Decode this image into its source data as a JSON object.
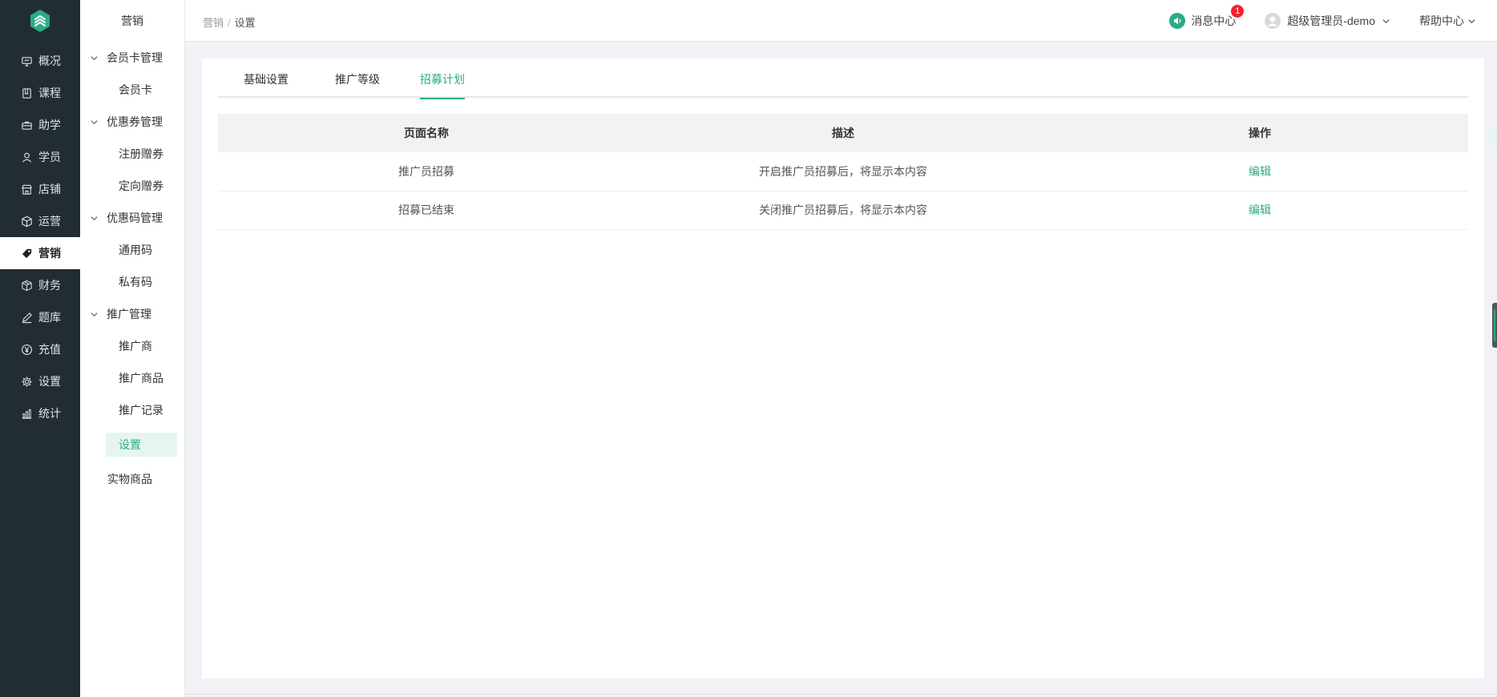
{
  "colors": {
    "accent": "#2dab85",
    "rail_bg": "#222d32",
    "badge": "#f5222d"
  },
  "rail": {
    "items": [
      {
        "label": "概况",
        "icon": "monitor-icon"
      },
      {
        "label": "课程",
        "icon": "book-icon"
      },
      {
        "label": "助学",
        "icon": "briefcase-icon"
      },
      {
        "label": "学员",
        "icon": "user-icon"
      },
      {
        "label": "店铺",
        "icon": "store-icon"
      },
      {
        "label": "运营",
        "icon": "cube-icon"
      },
      {
        "label": "营销",
        "icon": "tag-icon"
      },
      {
        "label": "财务",
        "icon": "box-icon"
      },
      {
        "label": "题库",
        "icon": "pen-icon"
      },
      {
        "label": "充值",
        "icon": "yen-circle-icon"
      },
      {
        "label": "设置",
        "icon": "gear-icon"
      },
      {
        "label": "统计",
        "icon": "bar-chart-icon"
      }
    ],
    "active": "营销"
  },
  "subnav": {
    "title": "营销",
    "groups": [
      {
        "label": "会员卡管理",
        "items": [
          "会员卡"
        ]
      },
      {
        "label": "优惠券管理",
        "items": [
          "注册赠券",
          "定向赠券"
        ]
      },
      {
        "label": "优惠码管理",
        "items": [
          "通用码",
          "私有码"
        ]
      },
      {
        "label": "推广管理",
        "items": [
          "推广商",
          "推广商品",
          "推广记录",
          "设置"
        ]
      }
    ],
    "extra": "实物商品",
    "active": "设置"
  },
  "breadcrumb": {
    "parent": "营销",
    "separator": "/",
    "current": "设置"
  },
  "header": {
    "messages_label": "消息中心",
    "messages_count": "1",
    "user_label": "超级管理员-demo",
    "help_label": "帮助中心"
  },
  "tabs": [
    {
      "label": "基础设置"
    },
    {
      "label": "推广等级"
    },
    {
      "label": "招募计划"
    }
  ],
  "active_tab": "招募计划",
  "table": {
    "headers": [
      "页面名称",
      "描述",
      "操作"
    ],
    "rows": [
      {
        "name": "推广员招募",
        "desc": "开启推广员招募后，将显示本内容",
        "action": "编辑"
      },
      {
        "name": "招募已结束",
        "desc": "关闭推广员招募后，将显示本内容",
        "action": "编辑"
      }
    ]
  }
}
